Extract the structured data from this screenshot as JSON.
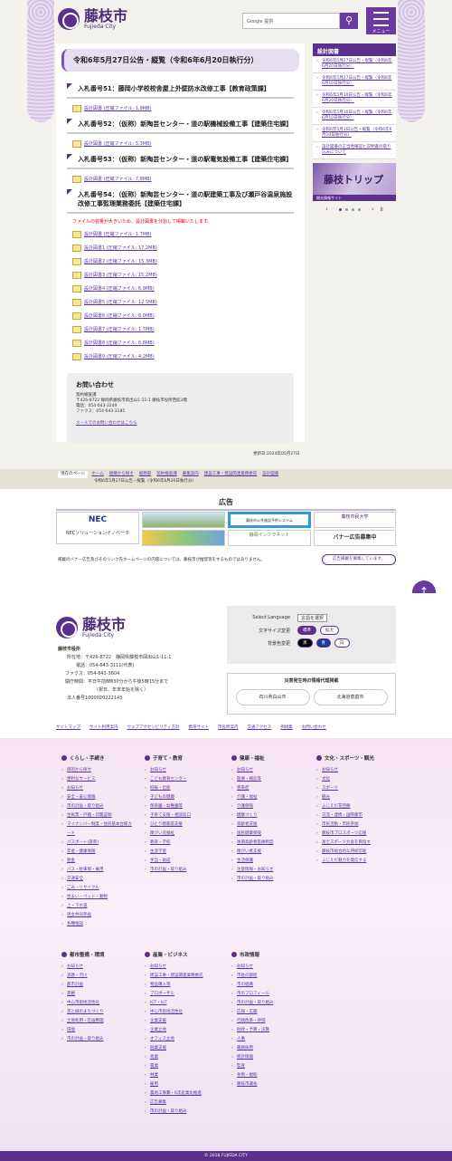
{
  "header": {
    "logo_text": "藤枝市",
    "logo_sub": "Fujieda City",
    "search_placeholder": "Google 提供",
    "menu_label": "メニュー"
  },
  "page": {
    "title": "令和6年5月27日公告・縦覧（令和6年6月20日執行分）",
    "sections": [
      {
        "heading": "入札番号51：藤岡小学校校舎屋上外壁防水改修工事【教育政策課】",
        "files": [
          "設計図書 (圧縮ファイル: 1.9MB)"
        ]
      },
      {
        "heading": "入札番号52：（仮称）新陶芸センター・道の駅機械設備工事【建築住宅課】",
        "files": [
          "設計図書 (圧縮ファイル: 5.3MB)"
        ]
      },
      {
        "heading": "入札番号53：（仮称）新陶芸センター・道の駅電気設備工事【建築住宅課】",
        "files": [
          "設計図書 (圧縮ファイル: 7.8MB)"
        ]
      },
      {
        "heading": "入札番号54：（仮称）新陶芸センター・道の駅建築工事及び瀬戸谷温泉施設改修工事監理業務委託【建築住宅課】",
        "warning": "ファイルの容量が大きいため、設計図書を分割して掲載いたします。",
        "files": [
          "設計図書 (圧縮ファイル: 1.7MB)",
          "設計図書1 (圧縮ファイル: 17.2MB)",
          "設計図書2 (圧縮ファイル: 15.3MB)",
          "設計図書3 (圧縮ファイル: 15.2MB)",
          "設計図書4 (圧縮ファイル: 6.9MB)",
          "設計図書5 (圧縮ファイル: 12.5MB)",
          "設計図書6 (圧縮ファイル: 6.0MB)",
          "設計図書7 (圧縮ファイル: 1.7MB)",
          "設計図書8 (圧縮ファイル: 6.8MB)",
          "設計図書9 (圧縮ファイル: 4.2MB)"
        ]
      }
    ],
    "contact": {
      "heading": "お問い合わせ",
      "lines": [
        "契約検査課",
        "〒426-8722 静岡県藤枝市岡出山1-11-1 藤枝市役所西館3階",
        "電話：054-643-3249",
        "ファクス：054-643-3185"
      ],
      "mail": "メールでのお問い合わせはこちら"
    },
    "updated": "更新日:2024年05月27日"
  },
  "sidebar": {
    "title": "設計図書",
    "items": [
      "令和6年5月27日公告・縦覧（令和6年6月20日執行分）",
      "令和6年5月27日公告・縦覧（令和6年6月10日執行分）",
      "令和6年5月10日公告・縦覧（令和6年6月20日執行分）",
      "令和6年5月10日公告・縦覧（令和6年6月10日執行分）",
      "令和6年5月1日公告・縦覧（令和6年6月10日執行分）",
      "設計図書の正当性確認と説明書の取り込みについて"
    ],
    "banner_text": "藤枝トリップ",
    "banner_foot": "観光情報サイト"
  },
  "breadcrumb": {
    "label": "現在のページ",
    "items": [
      "ホーム",
      "組織から探す",
      "総務部",
      "契約検査課",
      "募集案内",
      "建設工事・建設関連業務委託",
      "設計図書"
    ],
    "current": "令和6年5月27日公告・縦覧（令和6年6月20日執行分）"
  },
  "ads": {
    "title": "広告",
    "cells": [
      "NEC",
      "NECソリューションイノベータ",
      "",
      "藤枝市公共施設予約システム",
      "藤枝市民大学",
      "F家",
      "",
      "静岡インフラネット",
      "",
      "バナー広告募集中"
    ],
    "note": "掲載のバナー広告及びそのリンク先ホームページの内容については、藤枝市が推奨等をするものではありません。",
    "button": "広告掲載を募集しています。"
  },
  "footer": {
    "org": "藤枝市役所",
    "info": [
      "所在地：〒426-8722　静岡県藤枝市岡出山1-11-1",
      "電話：054-643-3111(代表)",
      "ファクス：054-643-3604",
      "開庁時間：平日午前8時30分から午後5時15分まで",
      "（祝日、年末年始を除く）",
      "法人番号1000020222143"
    ],
    "lang": {
      "label": "Select Language",
      "value": "言語を選択",
      "fontsize_label": "文字サイズ変更",
      "fs_normal": "標準",
      "fs_large": "拡大",
      "bg_label": "背景色変更",
      "bg_black": "黒",
      "bg_blue": "青",
      "bg_white": "白"
    },
    "disaster": {
      "title": "災害発生時の情報代理掲載",
      "left": "石川県白山市",
      "right": "北海道恵庭市"
    },
    "links": [
      "サイトマップ",
      "サイト利用案内",
      "ウェブアクセシビリティ方針",
      "携帯サイト",
      "市役所案内",
      "交通アクセス",
      "例規集",
      "お問い合わせ"
    ]
  },
  "sitemap": [
    {
      "title": "くらし・手続き",
      "items": [
        "目的から探す",
        "便利なサービス",
        "お知らせ",
        "安全・安心情報",
        "市の計画・取り組み",
        "住民票・戸籍・印鑑証明",
        "マイナンバー制度・住民基本台帳カード",
        "パスポート(旅券)",
        "年金・健康保険",
        "税金",
        "バス・駐車場・乗用",
        "交通安全",
        "ごみ・リサイクル",
        "住まい・ペット・動物",
        "上・下水道",
        "男女共同参画",
        "各種相談"
      ]
    },
    {
      "title": "子育て・教育",
      "items": [
        "お知らせ",
        "こども教育センター",
        "妊娠・出産",
        "子どもの健康",
        "保育園・幼稚園等",
        "子育て支援・相談窓口",
        "ひとり親家庭支援",
        "障がい児福祉",
        "教育・学校",
        "生涯学習",
        "手当・助成",
        "市の計画・取り組み"
      ]
    },
    {
      "title": "健康・福祉",
      "items": [
        "お知らせ",
        "医療・検診等",
        "感染症",
        "介護・福祉",
        "介護保険",
        "健康づくり",
        "高齢者支援",
        "国民健康保険",
        "後期高齢者医療制度",
        "障がい者支援",
        "生活保護",
        "注意情報・お知らせ",
        "市の計画・取り組み"
      ]
    },
    {
      "title": "文化・スポーツ・観光",
      "items": [
        "お知らせ",
        "文化",
        "スポーツ",
        "観光",
        "ふじえだ花回廊",
        "交流・連携・国際都市",
        "市民活動・市民参加",
        "藤枝市プロスポーツ応援",
        "富士スポーツ大会を目指す",
        "藤枝市総合的な持続可能",
        "ふじえだ魅力を発信する"
      ]
    },
    {
      "title": "都市整備・環境",
      "items": [
        "お知らせ",
        "道路・河川",
        "都市計画",
        "景観",
        "中心市街地活性化",
        "花と緑のまちづくり",
        "土地利用・区画整理",
        "環境",
        "市の計画・取り組み"
      ]
    },
    {
      "title": "産業・ビジネス",
      "items": [
        "お知らせ",
        "建設工事・建設関連業務委託",
        "物品購入等",
        "プロポーザル",
        "ICT・IoT",
        "中心市街地活性化",
        "企業支援",
        "企業立地",
        "オフィス立地",
        "創業支援",
        "商業",
        "農業",
        "林業",
        "雇用",
        "農地工事費・6次産業化推進",
        "広告募集",
        "市の計画・取り組み"
      ]
    },
    {
      "title": "市政情報",
      "items": [
        "お知らせ",
        "市長の部屋",
        "市の組織",
        "市のプロフィール",
        "市の計画・取り組み",
        "広報・広聴",
        "行政改革・評価",
        "財政・予算・決算",
        "人事",
        "職員採用",
        "統計情報",
        "監査",
        "条例・規則",
        "藤枝市議会"
      ]
    }
  ],
  "copyright": "© 2018 FUJIEDA CITY"
}
